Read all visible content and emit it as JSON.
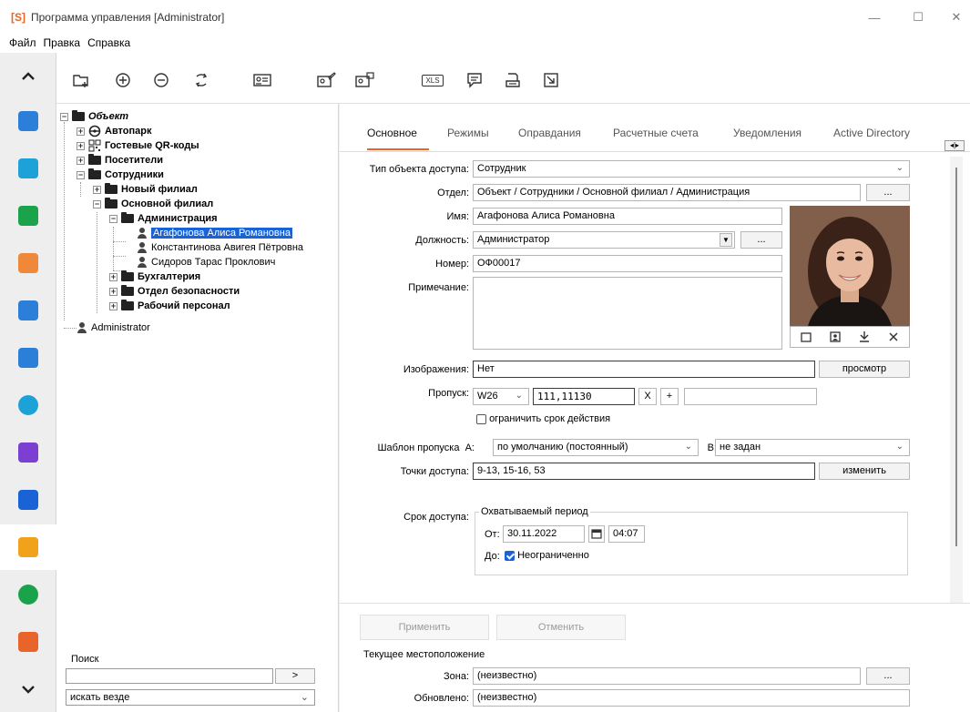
{
  "window": {
    "logo": "[S]",
    "title": "Программа управления [Administrator]",
    "min_label": "—",
    "max_label": "☐",
    "close_label": "✕"
  },
  "menu": [
    "Файл",
    "Правка",
    "Справка"
  ],
  "sidebar": {
    "up_label": "^",
    "down_label": "⌄",
    "items": [
      {
        "icon": "network-icon",
        "color": "#2b7fd8"
      },
      {
        "icon": "calendar-icon",
        "color": "#1da2d8"
      },
      {
        "icon": "monitor-icon",
        "color": "#1aa34a"
      },
      {
        "icon": "photo-frame-icon",
        "color": "#f0883a"
      },
      {
        "icon": "keyboard-icon",
        "color": "#2b7fd8"
      },
      {
        "icon": "keyboard-auto-icon",
        "color": "#2b7fd8"
      },
      {
        "icon": "payment-gear-icon",
        "color": "#1da2d8"
      },
      {
        "icon": "parking-cards-icon",
        "color": "#7b3fd1"
      },
      {
        "icon": "document-p-icon",
        "color": "#1a63d6"
      },
      {
        "icon": "users-icon",
        "color": "#f0a21a"
      },
      {
        "icon": "clock-icon",
        "color": "#1aa34a"
      },
      {
        "icon": "guard-icon",
        "color": "#e8642a"
      }
    ]
  },
  "toolbar": {
    "xls_label": "XLS"
  },
  "tree": {
    "root": "Объект",
    "items": [
      {
        "label": "Автопарк"
      },
      {
        "label": "Гостевые QR-коды"
      },
      {
        "label": "Посетители"
      },
      {
        "label": "Сотрудники"
      },
      {
        "label": "Новый филиал"
      },
      {
        "label": "Основной филиал"
      },
      {
        "label": "Администрация"
      },
      {
        "label": "Агафонова Алиса Романовна"
      },
      {
        "label": "Константинова Авигея Пётровна"
      },
      {
        "label": "Сидоров Тарас Проклович"
      },
      {
        "label": "Бухгалтерия"
      },
      {
        "label": "Отдел безопасности"
      },
      {
        "label": "Рабочий персонал"
      },
      {
        "label": "Administrator"
      }
    ]
  },
  "search": {
    "label": "Поиск",
    "value": "",
    "go_label": ">",
    "scope": "искать везде"
  },
  "tabs": [
    "Основное",
    "Режимы",
    "Оправдания",
    "Расчетные счета",
    "Уведомления",
    "Active Directory"
  ],
  "tab_scroll": "◂|▸",
  "form": {
    "type_label": "Тип объекта доступа:",
    "type_value": "Сотрудник",
    "dept_label": "Отдел:",
    "dept_value": "Объект / Сотрудники / Основной филиал / Администрация",
    "dots": "...",
    "name_label": "Имя:",
    "name_value": "Агафонова Алиса Романовна",
    "position_label": "Должность:",
    "position_value": "Администратор",
    "number_label": "Номер:",
    "number_value": "ОФ00017",
    "note_label": "Примечание:",
    "note_value": "",
    "images_label": "Изображения:",
    "images_value": "Нет",
    "view_label": "просмотр",
    "pass_label": "Пропуск:",
    "pass_type": "W26",
    "pass_code": "111,11130",
    "pass_x": "X",
    "pass_plus": "+",
    "pass_extra": "",
    "limit_label": "ограничить срок действия",
    "template_label": "Шаблон пропуска",
    "template_a_label": "А:",
    "template_a_value": "по умолчанию (постоянный)",
    "template_b_label": "В:",
    "template_b_value": "не задан",
    "points_label": "Точки доступа:",
    "points_value": "9-13, 15-16, 53",
    "change_label": "изменить",
    "term_label": "Срок доступа:",
    "period_label": "Охватываемый период",
    "from_label": "От:",
    "from_date": "30.11.2022",
    "from_time": "04:07",
    "to_label": "До:",
    "unlimited_label": "Неограниченно"
  },
  "bottom": {
    "apply_label": "Применить",
    "cancel_label": "Отменить",
    "location_label": "Текущее местоположение",
    "zone_label": "Зона:",
    "zone_value": "(неизвестно)",
    "updated_label": "Обновлено:",
    "updated_value": "(неизвестно)"
  }
}
